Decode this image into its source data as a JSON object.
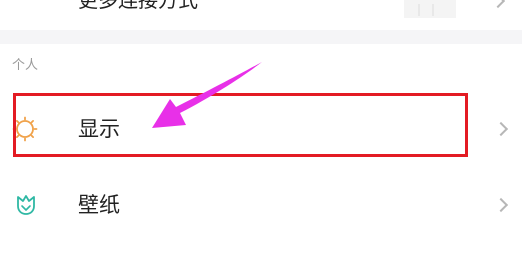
{
  "top_row": {
    "label": "更多连接方式"
  },
  "section": {
    "header": "个人"
  },
  "rows": [
    {
      "label": "显示",
      "icon": "sun-icon",
      "icon_color": "#f0a24a"
    },
    {
      "label": "壁纸",
      "icon": "tulip-icon",
      "icon_color": "#2fb8a4"
    }
  ],
  "annotation": {
    "box_color": "#e31b23",
    "arrow_color": "#e830e8"
  }
}
